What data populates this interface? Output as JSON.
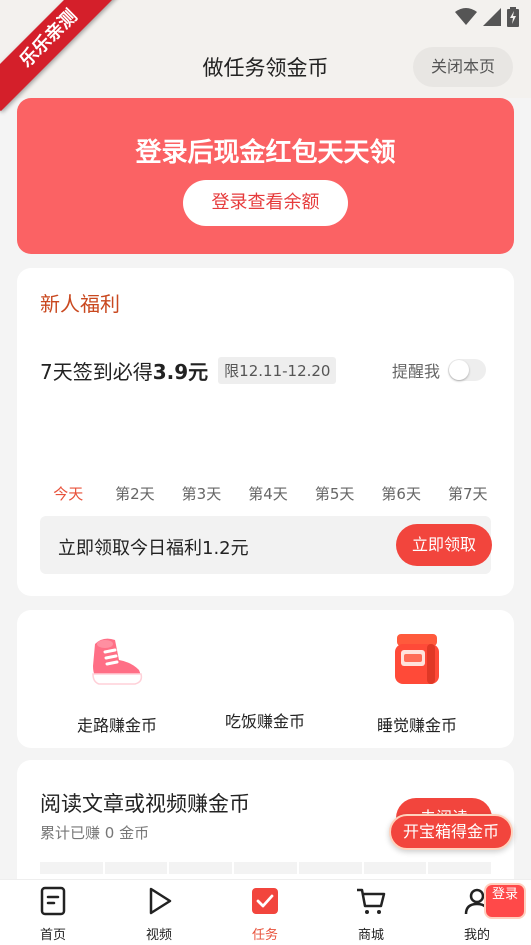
{
  "ribbon": "乐乐亲测",
  "header": {
    "title": "做任务领金币",
    "close_label": "关闭本页"
  },
  "banner": {
    "title": "登录后现金红包天天领",
    "button": "登录查看余额"
  },
  "newbie": {
    "title": "新人福利",
    "sign_prefix": "7天签到必得",
    "sign_amount": "3.9元",
    "limit": "限12.11-12.20",
    "remind_label": "提醒我",
    "remind_on": false,
    "days": [
      "今天",
      "第2天",
      "第3天",
      "第4天",
      "第5天",
      "第6天",
      "第7天"
    ],
    "claim_text": "立即领取今日福利1.2元",
    "claim_button": "立即领取"
  },
  "earn": [
    {
      "label": "走路赚金币",
      "icon": "shoe-icon"
    },
    {
      "label": "吃饭赚金币",
      "icon": "meal-icon"
    },
    {
      "label": "睡觉赚金币",
      "icon": "alarm-icon"
    }
  ],
  "read": {
    "title": "阅读文章或视频赚金币",
    "subtitle": "累计已赚 0 金币",
    "go_button": "去阅读"
  },
  "float_button": "开宝箱得金币",
  "tabs": [
    {
      "label": "首页",
      "icon": "home-icon"
    },
    {
      "label": "视频",
      "icon": "video-icon"
    },
    {
      "label": "任务",
      "icon": "task-icon",
      "active": true
    },
    {
      "label": "商城",
      "icon": "cart-icon"
    },
    {
      "label": "我的",
      "icon": "user-icon"
    }
  ],
  "login_badge": "登录",
  "colors": {
    "accent": "#f2453d",
    "banner": "#fb6264",
    "newbie_title": "#c9481f"
  }
}
